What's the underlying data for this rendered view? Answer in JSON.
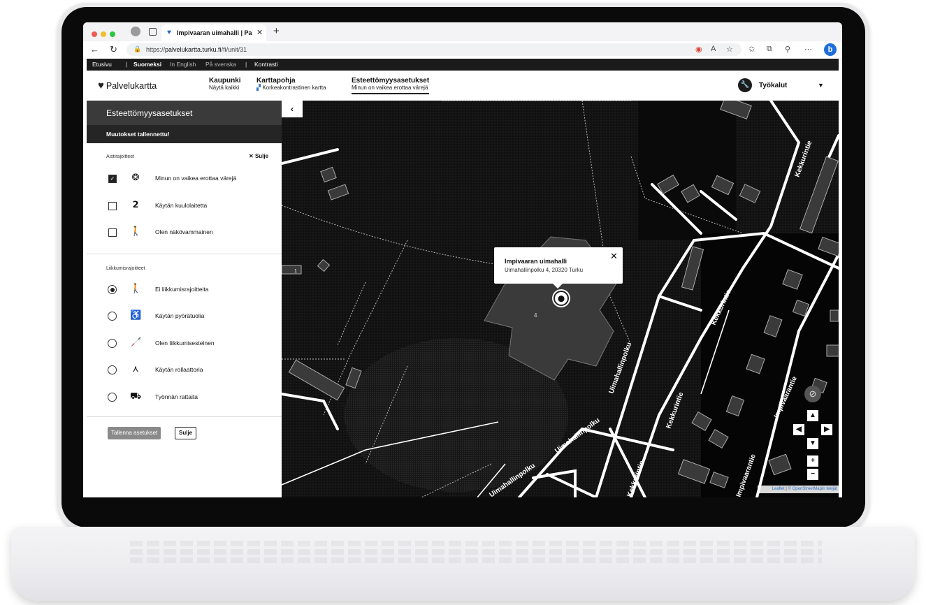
{
  "browser": {
    "tab_title": "Impivaaran uimahalli | Palvelukartta",
    "url_prefix": "https://",
    "url_host": "palvelukartta.turku.fi",
    "url_path": "/fi/unit/31"
  },
  "topbar": {
    "home": "Etusivu",
    "lang_fi": "Suomeksi",
    "lang_en": "In English",
    "lang_sv": "På svenska",
    "contrast": "Kontrasti"
  },
  "header": {
    "logo": "Palvelukartta",
    "city_title": "Kaupunki",
    "city_sub": "Näytä kaikki",
    "basemap_title": "Karttapohja",
    "basemap_sub": "Korkeakontrastinen kartta",
    "access_title": "Esteettömyysasetukset",
    "access_sub": "Minun on vaikea erottaa värejä",
    "tools": "Työkalut"
  },
  "sidebar": {
    "title": "Esteettömyysasetukset",
    "saved_msg": "Muutokset tallennettu!",
    "sense_title": "Aistirajoitteet",
    "close_label": "Sulje",
    "sense_options": [
      {
        "label": "Minun on vaikea erottaa värejä",
        "checked": true,
        "icon": "color-blind-icon"
      },
      {
        "label": "Käytän kuulolaitetta",
        "checked": false,
        "icon": "hearing-aid-icon"
      },
      {
        "label": "Olen näkövammainen",
        "checked": false,
        "icon": "visually-impaired-icon"
      }
    ],
    "mobility_title": "Liikkumisrajoitteet",
    "mobility_options": [
      {
        "label": "Ei liikkumisrajoitteita",
        "selected": true,
        "icon": "walking-icon"
      },
      {
        "label": "Käytän pyörätuolia",
        "selected": false,
        "icon": "wheelchair-icon"
      },
      {
        "label": "Olen liikkumisesteinen",
        "selected": false,
        "icon": "reduced-mobility-icon"
      },
      {
        "label": "Käytän rollaattoria",
        "selected": false,
        "icon": "rollator-icon"
      },
      {
        "label": "Työnnän rattaita",
        "selected": false,
        "icon": "stroller-icon"
      }
    ],
    "save_button": "Tallenna asetukset",
    "close_button": "Sulje"
  },
  "map": {
    "popup_title": "Impivaaran uimahalli",
    "popup_address": "Uimahallinpolku 4, 20320 Turku",
    "building_number": "4",
    "parcel_number": "1",
    "streets": [
      "Kekkurintie",
      "Uimahallinpolku",
      "Impivaarantie"
    ],
    "attribution_leaflet": "Leaflet",
    "attribution_osm": "© OpenStreetMapin tekijät",
    "zoom_in": "+",
    "zoom_out": "−"
  },
  "colors": {
    "map_bg": "#0e0e0e",
    "road": "#ffffff",
    "building": "#3a3a3a",
    "header_dark": "#1b1b1b"
  }
}
